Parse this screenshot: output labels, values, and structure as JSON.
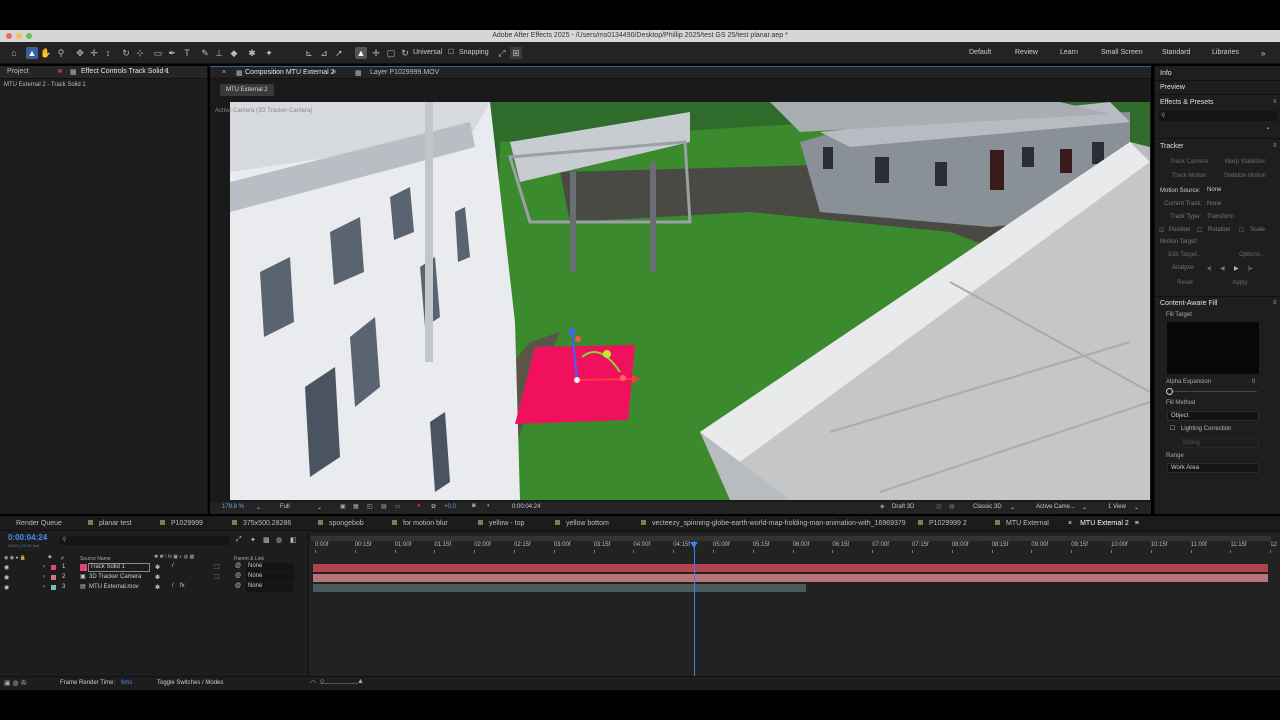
{
  "window": {
    "title": "Adobe After Effects 2025 - /Users/ms0134490/Desktop/Phillip 2025/test GS 25/test planar.aep *"
  },
  "workspaces": [
    "Default",
    "Review",
    "Learn",
    "Small Screen",
    "Standard",
    "Libraries"
  ],
  "toolbar": {
    "universal_label": "Universal",
    "snapping_label": "Snapping"
  },
  "left_panel": {
    "tabs": [
      "Project",
      "Effect Controls Track Solid 1"
    ],
    "subtitle": "MTU External 2 - Track Solid 1"
  },
  "comp_panel": {
    "tabs": [
      "Composition MTU External 2",
      "Layer P1029999.MOV"
    ],
    "breadcrumb": "MTU External 2",
    "view_label": "Active Camera (3D Tracker Camera)",
    "zoom": "179.8 %",
    "resolution": "Full",
    "exposure": "+0.0",
    "timecode": "0:00:04:24",
    "renderer_mode": "Draft 3D",
    "renderer": "Classic 3D",
    "camera": "Active Came...",
    "views": "1 View"
  },
  "right_panel": {
    "info": "Info",
    "preview": "Preview",
    "effects_presets": "Effects & Presets",
    "tracker": {
      "title": "Tracker",
      "track_camera": "Track Camera",
      "warp_stabilizer": "Warp Stabilizer",
      "track_motion": "Track Motion",
      "stabilize_motion": "Stabilize Motion",
      "motion_source_label": "Motion Source:",
      "motion_source_value": "None",
      "current_track_label": "Current Track:",
      "current_track_value": "None",
      "track_type_label": "Track Type:",
      "track_type_value": "Transform",
      "position": "Position",
      "rotation": "Rotation",
      "scale": "Scale",
      "motion_target": "Motion Target:",
      "edit_target": "Edit Target...",
      "options": "Options...",
      "analyze": "Analyze:",
      "reset": "Reset",
      "apply": "Apply"
    },
    "caf": {
      "title": "Content-Aware Fill",
      "fill_target": "Fill Target",
      "alpha_expansion": "Alpha Expansion",
      "alpha_value": "0",
      "fill_method": "Fill Method",
      "fill_method_value": "Object",
      "lighting_correction": "Lighting Correction",
      "strength": "Strong",
      "range": "Range",
      "range_value": "Work Area"
    }
  },
  "timeline": {
    "tabs": [
      {
        "label": "Render Queue",
        "color": ""
      },
      {
        "label": "planar test",
        "color": "#8a7a50"
      },
      {
        "label": "P1029999",
        "color": "#8a7a50"
      },
      {
        "label": "375x500.28286",
        "color": "#8a7a50"
      },
      {
        "label": "spongebob",
        "color": "#8a7a50"
      },
      {
        "label": "for motion blur",
        "color": "#8a7a50"
      },
      {
        "label": "yellow - top",
        "color": "#8a7a50"
      },
      {
        "label": "yellow bottom",
        "color": "#8a7a50"
      },
      {
        "label": "vecteezy_spinning-globe-earth-world-map-holding-man-animation-with_16969379",
        "color": "#8a7a50"
      },
      {
        "label": "P1029999 2",
        "color": "#8a7a50"
      },
      {
        "label": "MTU External",
        "color": "#8a7a50"
      },
      {
        "label": "MTU External 2",
        "color": "#8a7a50"
      }
    ],
    "current_time": "0:00:04:24",
    "frame_info": "00124 (25.00 fps)",
    "columns": {
      "num": "#",
      "source_name": "Source Name",
      "parent_link": "Parent & Link"
    },
    "ruler": [
      "0:00f",
      "00:15f",
      "01:00f",
      "01:15f",
      "02:00f",
      "02:15f",
      "03:00f",
      "03:15f",
      "04:00f",
      "04:15f",
      "05:00f",
      "05:15f",
      "06:00f",
      "06:15f",
      "07:00f",
      "07:15f",
      "08:00f",
      "08:15f",
      "09:00f",
      "09:15f",
      "10:00f",
      "10:15f",
      "11:00f",
      "11:15f",
      "12"
    ],
    "layers": [
      {
        "num": "1",
        "name": "Track Solid 1",
        "parent": "None",
        "label_color": "#e0457a",
        "bar_color": "#b0454e"
      },
      {
        "num": "2",
        "name": "3D Tracker Camera",
        "parent": "None",
        "label_color": "#d47a7a",
        "bar_color": "#b87479"
      },
      {
        "num": "3",
        "name": "MTU External.mov",
        "parent": "None",
        "label_color": "#7ac0b0",
        "bar_color": "#4a5a58"
      }
    ]
  },
  "status": {
    "frame_render_label": "Frame Render Time:",
    "frame_render_value": "6ms",
    "toggle_label": "Toggle Switches / Modes"
  }
}
